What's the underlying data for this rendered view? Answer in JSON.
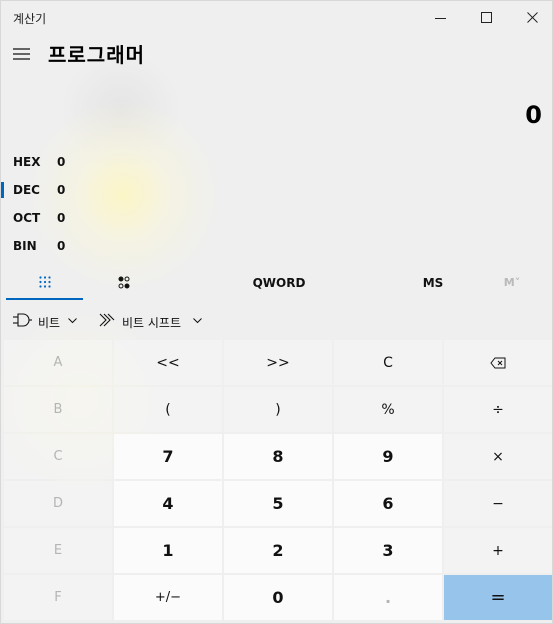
{
  "window": {
    "title": "계산기"
  },
  "header": {
    "mode_title": "프로그래머"
  },
  "display": {
    "value": "0"
  },
  "radix": [
    {
      "label": "HEX",
      "value": "0",
      "selected": false
    },
    {
      "label": "DEC",
      "value": "0",
      "selected": true
    },
    {
      "label": "OCT",
      "value": "0",
      "selected": false
    },
    {
      "label": "BIN",
      "value": "0",
      "selected": false
    }
  ],
  "tabs": {
    "word_size": "QWORD",
    "ms": "MS",
    "mplus": "M˅"
  },
  "dropdowns": {
    "bitwise": "비트",
    "bitshift": "비트 시프트"
  },
  "keys": {
    "A": "A",
    "B": "B",
    "C_hex": "C",
    "D": "D",
    "E": "E",
    "F": "F",
    "lsh": "<<",
    "rsh": ">>",
    "clear": "C",
    "backspace": "⌫",
    "lparen": "(",
    "rparen": ")",
    "percent": "%",
    "divide": "÷",
    "n7": "7",
    "n8": "8",
    "n9": "9",
    "multiply": "×",
    "n4": "4",
    "n5": "5",
    "n6": "6",
    "minus": "−",
    "n1": "1",
    "n2": "2",
    "n3": "3",
    "plus": "+",
    "negate": "+/−",
    "n0": "0",
    "decimal": ".",
    "equals": "="
  },
  "colors": {
    "accent": "#0067c0",
    "equals_bg": "#96c4ea",
    "number_key_bg": "#fbfbfb",
    "disabled_text": "#b4b4b4"
  }
}
